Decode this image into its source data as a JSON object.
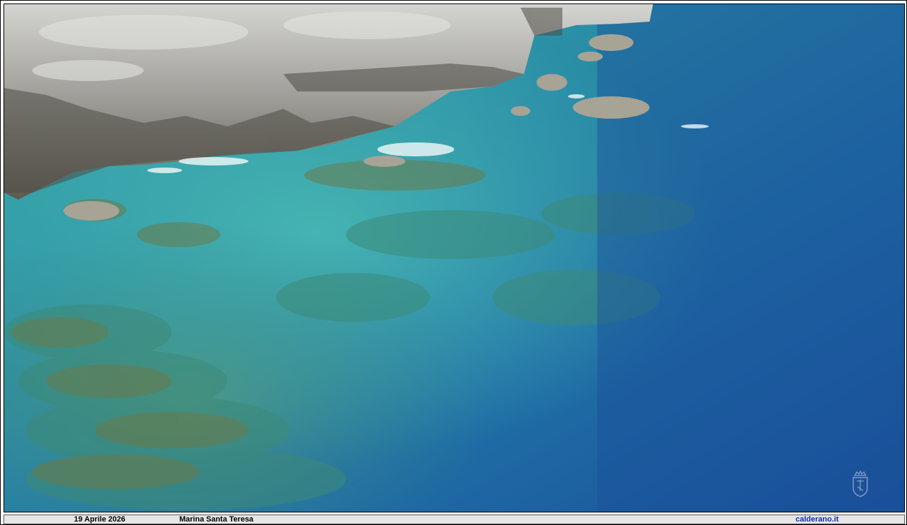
{
  "photo": {
    "subject": "aerial-sea-cliff",
    "watermark_icon": "crest-icon",
    "colors": {
      "deep_sea": "#1c57a0",
      "shallow_sea": "#2f9ea8",
      "rock": "#a9a9a5",
      "seaweed": "#5f7048"
    }
  },
  "caption": {
    "date": "19 Aprile 2026",
    "place": "Marina Santa Teresa",
    "site": "calderano.it"
  }
}
